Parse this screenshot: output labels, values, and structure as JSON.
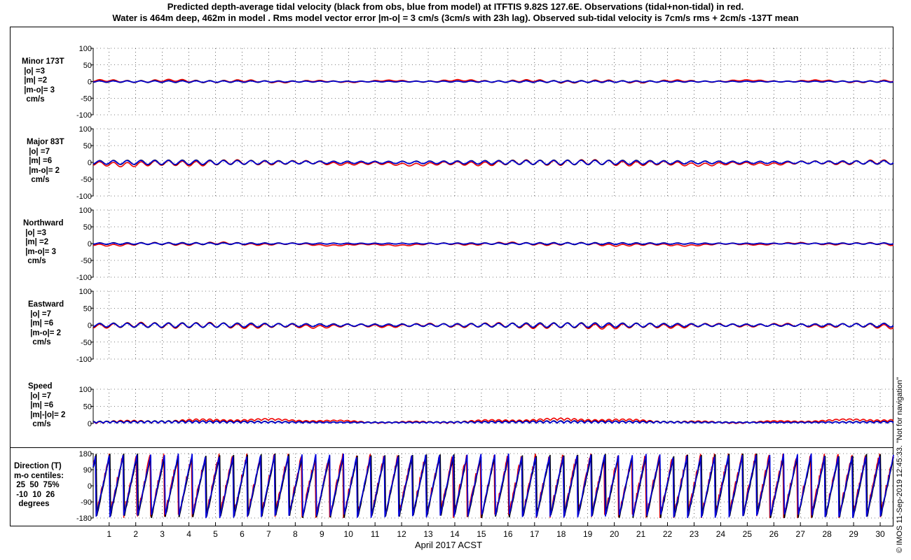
{
  "title_line1": "Predicted depth-average tidal velocity (black from obs, blue from model) at ITFTIS 9.82S 127.6E. Observations (tidal+non-tidal) in red.",
  "title_line2": "Water is 464m deep, 462m in model . Rms model vector error |m-o| = 3 cm/s (3cm/s with 23h lag). Observed sub-tidal velocity is 7cm/s rms + 2cm/s -137T mean",
  "xlabel": "April 2017 ACST",
  "credit": "© IMOS 11-Sep-2019 12:45:33.  \"Not for navigation\"",
  "colors": {
    "obs": "#000000",
    "model": "#0000dd",
    "observations": "#ee0000",
    "grid": "#000000"
  },
  "chart_data": {
    "type": "line",
    "x_ticks": [
      "1",
      "2",
      "3",
      "4",
      "5",
      "6",
      "7",
      "8",
      "9",
      "10",
      "11",
      "12",
      "13",
      "14",
      "15",
      "16",
      "17",
      "18",
      "19",
      "20",
      "21",
      "22",
      "23",
      "24",
      "25",
      "26",
      "27",
      "28",
      "29",
      "30"
    ],
    "x_range_days": [
      0.4,
      30.5
    ],
    "series_names": [
      "tidal from obs (black)",
      "tidal from model (blue)",
      "observations (red)"
    ],
    "panels": [
      {
        "label": [
          "Minor 173T",
          " |o| =3",
          " |m| =2",
          " |m-o|= 3",
          "  cm/s"
        ],
        "ylim": [
          -100,
          100
        ],
        "yticks": [
          "100",
          "50",
          "0",
          "-50",
          "-100"
        ],
        "amp_obs": 3,
        "amp_model": 2,
        "obs_offset": 2
      },
      {
        "label": [
          "Major 83T",
          " |o| =7",
          " |m| =6",
          " |m-o|= 2",
          "  cm/s"
        ],
        "ylim": [
          -100,
          100
        ],
        "yticks": [
          "100",
          "50",
          "0",
          "-50",
          "-100"
        ],
        "amp_obs": 7,
        "amp_model": 6,
        "obs_offset": -5
      },
      {
        "label": [
          "Northward",
          " |o| =3",
          " |m| =2",
          " |m-o|= 3",
          "  cm/s"
        ],
        "ylim": [
          -100,
          100
        ],
        "yticks": [
          "100",
          "50",
          "0",
          "-50",
          "-100"
        ],
        "amp_obs": 3,
        "amp_model": 2,
        "obs_offset": -4
      },
      {
        "label": [
          "Eastward",
          " |o| =7",
          " |m| =6",
          " |m-o|= 2",
          "  cm/s"
        ],
        "ylim": [
          -100,
          100
        ],
        "yticks": [
          "100",
          "50",
          "0",
          "-50",
          "-100"
        ],
        "amp_obs": 7,
        "amp_model": 6,
        "obs_offset": -3
      },
      {
        "label": [
          "Speed",
          " |o| =7",
          " |m| =6",
          " |m|-|o|= 2",
          "  cm/s"
        ],
        "ylim": [
          0,
          100
        ],
        "yticks": [
          "100",
          "50",
          "0"
        ],
        "amp_obs": 7,
        "amp_model": 6,
        "obs_offset": 6
      },
      {
        "label": [
          "Direction (T)",
          "m-o centiles:",
          " 25  50  75%",
          " -10  10  26",
          "  degrees"
        ],
        "ylim": [
          -180,
          180
        ],
        "yticks": [
          "180",
          "90",
          "0",
          "-90",
          "-180"
        ],
        "centiles": {
          "p25": -10,
          "p50": 10,
          "p75": 26
        }
      }
    ]
  }
}
